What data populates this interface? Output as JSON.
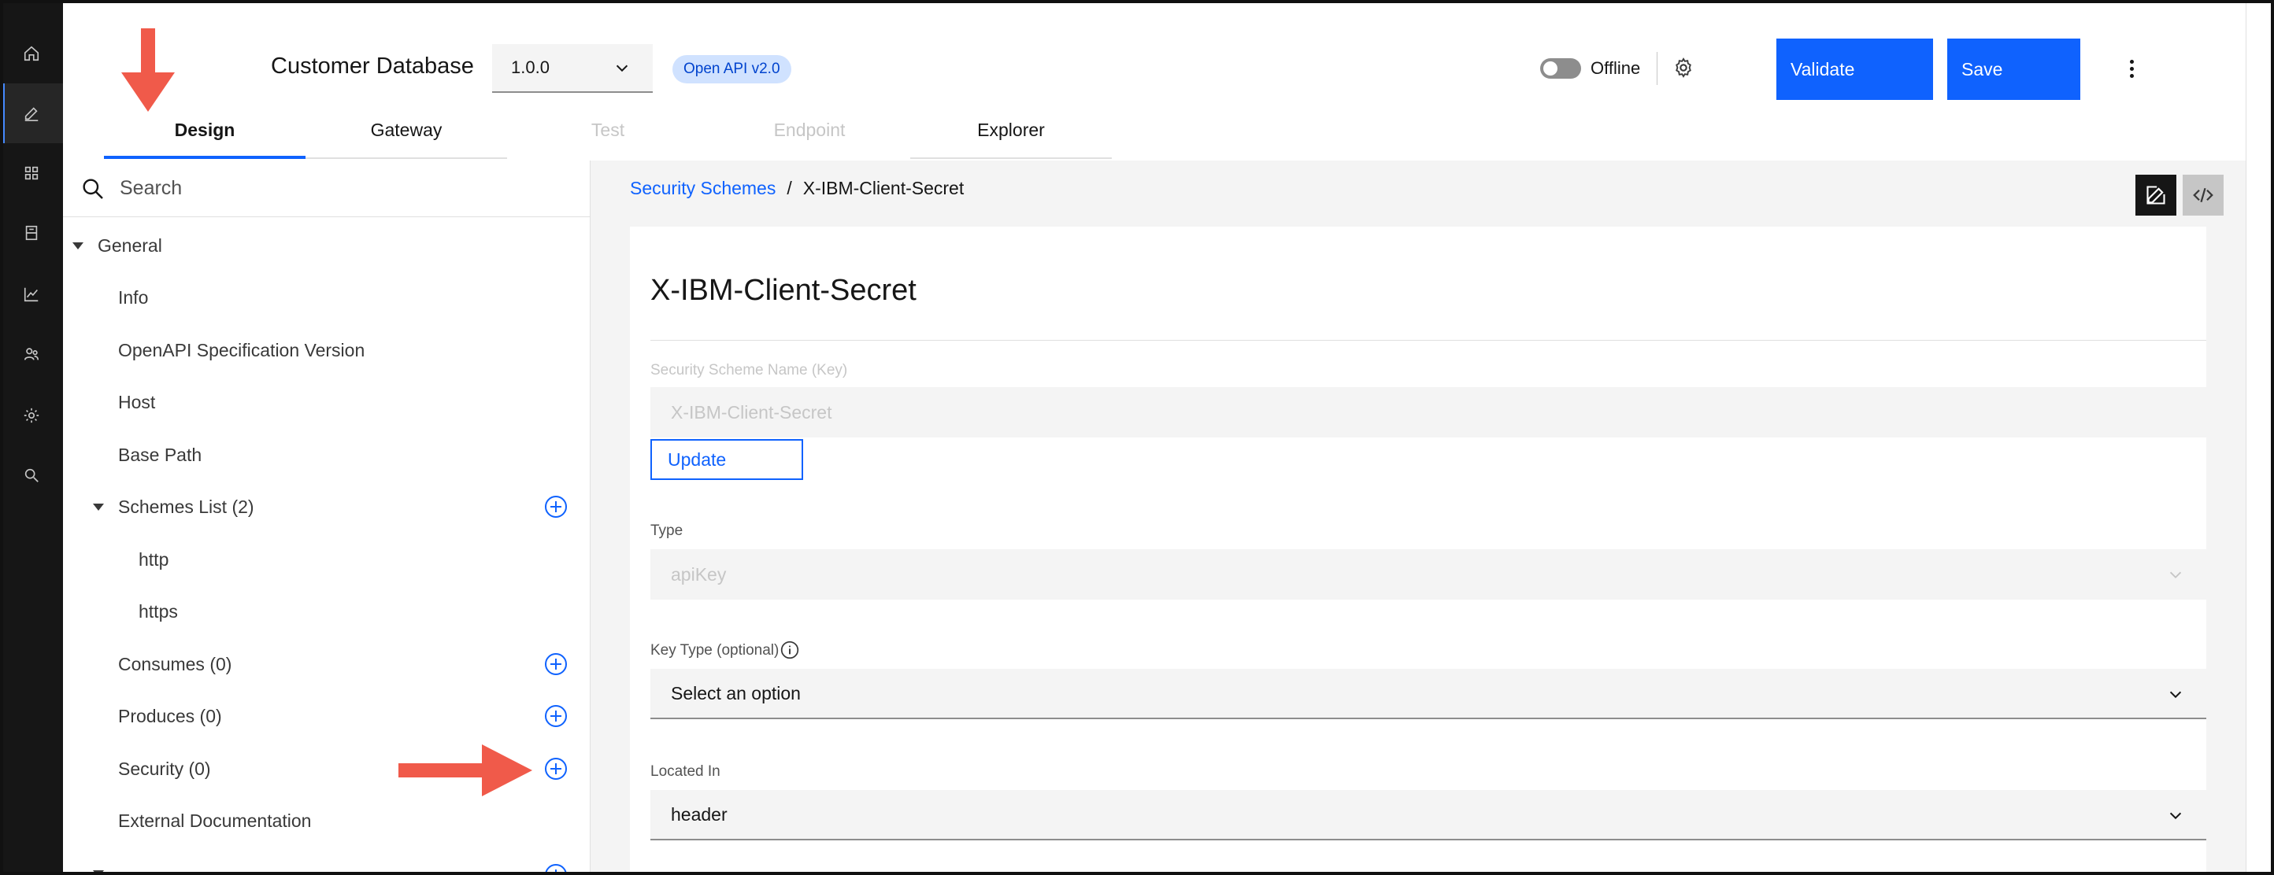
{
  "app": {
    "title": "Customer Database",
    "version": "1.0.0",
    "api_badge": "Open API v2.0",
    "offline_label": "Offline",
    "validate_label": "Validate",
    "save_label": "Save"
  },
  "rail": {
    "items": [
      {
        "icon": "home-icon"
      },
      {
        "icon": "edit-icon",
        "active": true
      },
      {
        "icon": "apps-icon"
      },
      {
        "icon": "catalog-icon"
      },
      {
        "icon": "analytics-icon"
      },
      {
        "icon": "users-icon"
      },
      {
        "icon": "settings-icon"
      },
      {
        "icon": "search-icon"
      }
    ]
  },
  "tabs": [
    {
      "label": "Design",
      "state": "active"
    },
    {
      "label": "Gateway",
      "state": "enabled"
    },
    {
      "label": "Test",
      "state": "disabled"
    },
    {
      "label": "Endpoint",
      "state": "disabled"
    },
    {
      "label": "Explorer",
      "state": "enabled"
    }
  ],
  "sidebar": {
    "search_placeholder": "Search",
    "items": [
      {
        "label": "General"
      },
      {
        "label": "Info"
      },
      {
        "label": "OpenAPI Specification Version"
      },
      {
        "label": "Host"
      },
      {
        "label": "Base Path"
      },
      {
        "label": "Schemes List (2)"
      },
      {
        "label": "http"
      },
      {
        "label": "https"
      },
      {
        "label": "Consumes (0)"
      },
      {
        "label": "Produces (0)"
      },
      {
        "label": "Security (0)"
      },
      {
        "label": "External Documentation"
      }
    ]
  },
  "main": {
    "breadcrumb": {
      "parent": "Security Schemes",
      "separator": "/",
      "current": "X-IBM-Client-Secret"
    },
    "title": "X-IBM-Client-Secret",
    "scheme_name_label": "Security Scheme Name (Key)",
    "scheme_name_value": "X-IBM-Client-Secret",
    "update_label": "Update",
    "type_label": "Type",
    "type_value": "apiKey",
    "key_type_label": "Key Type (optional)",
    "key_type_value": "Select an option",
    "located_in_label": "Located In",
    "located_in_value": "header"
  },
  "colors": {
    "accent": "#0f62fe",
    "rail_bg": "#161616",
    "annotation_arrow": "#f05a4a",
    "badge_bg": "#d0e2ff"
  }
}
